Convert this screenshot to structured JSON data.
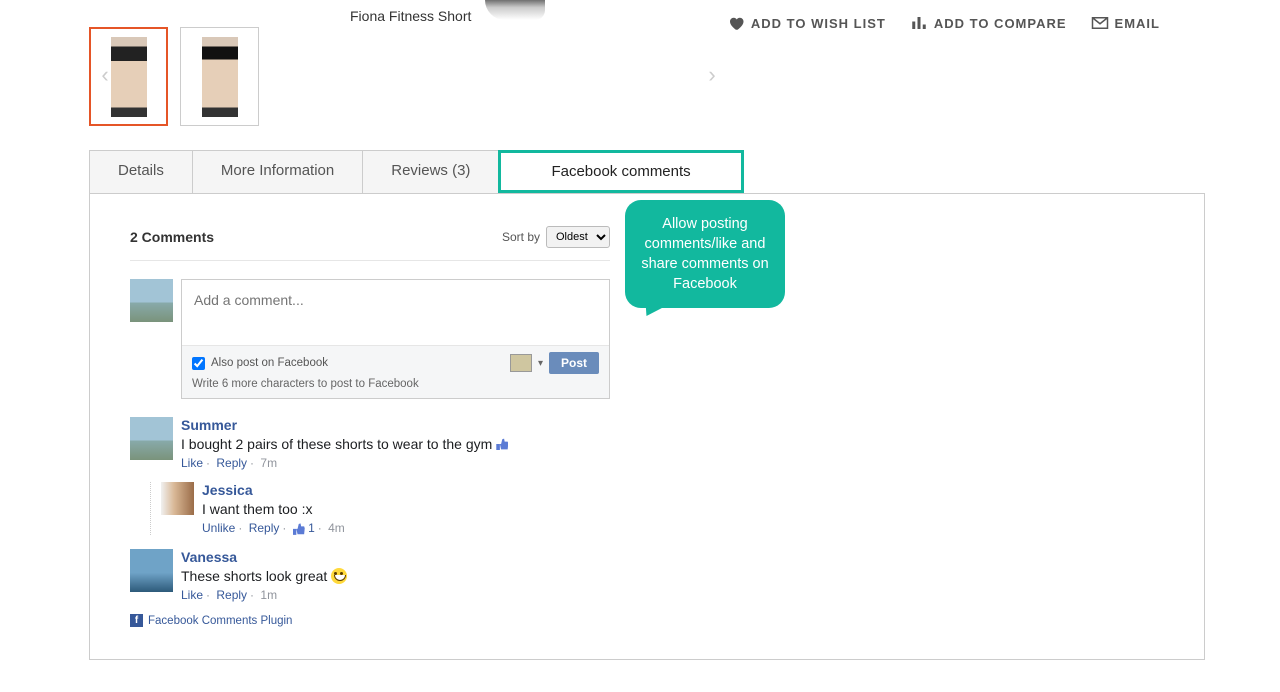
{
  "product": {
    "title_small": "Fiona Fitness Short"
  },
  "actions": {
    "wishlist": "ADD TO WISH LIST",
    "compare": "ADD TO COMPARE",
    "email": "EMAIL"
  },
  "tabs": {
    "details": "Details",
    "more_info": "More Information",
    "reviews": "Reviews (3)",
    "fb_comments": "Facebook comments"
  },
  "callout": {
    "text": "Allow posting comments/like and share comments on Facebook"
  },
  "fb": {
    "count_label": "2 Comments",
    "sort_label": "Sort by",
    "sort_value": "Oldest",
    "compose": {
      "placeholder": "Add a comment...",
      "also_post": "Also post on Facebook",
      "hint": "Write 6 more characters to post to Facebook",
      "post_btn": "Post"
    },
    "comments": [
      {
        "author": "Summer",
        "text": "I bought 2 pairs of these shorts to wear to the gym",
        "like_label": "Like",
        "reply_label": "Reply",
        "time": "7m",
        "reply": {
          "author": "Jessica",
          "text": "I want them too :x",
          "unlike_label": "Unlike",
          "reply_label": "Reply",
          "likes": "1",
          "time": "4m"
        }
      },
      {
        "author": "Vanessa",
        "text": "These shorts look great",
        "like_label": "Like",
        "reply_label": "Reply",
        "time": "1m"
      }
    ],
    "plugin_link": "Facebook Comments Plugin"
  }
}
